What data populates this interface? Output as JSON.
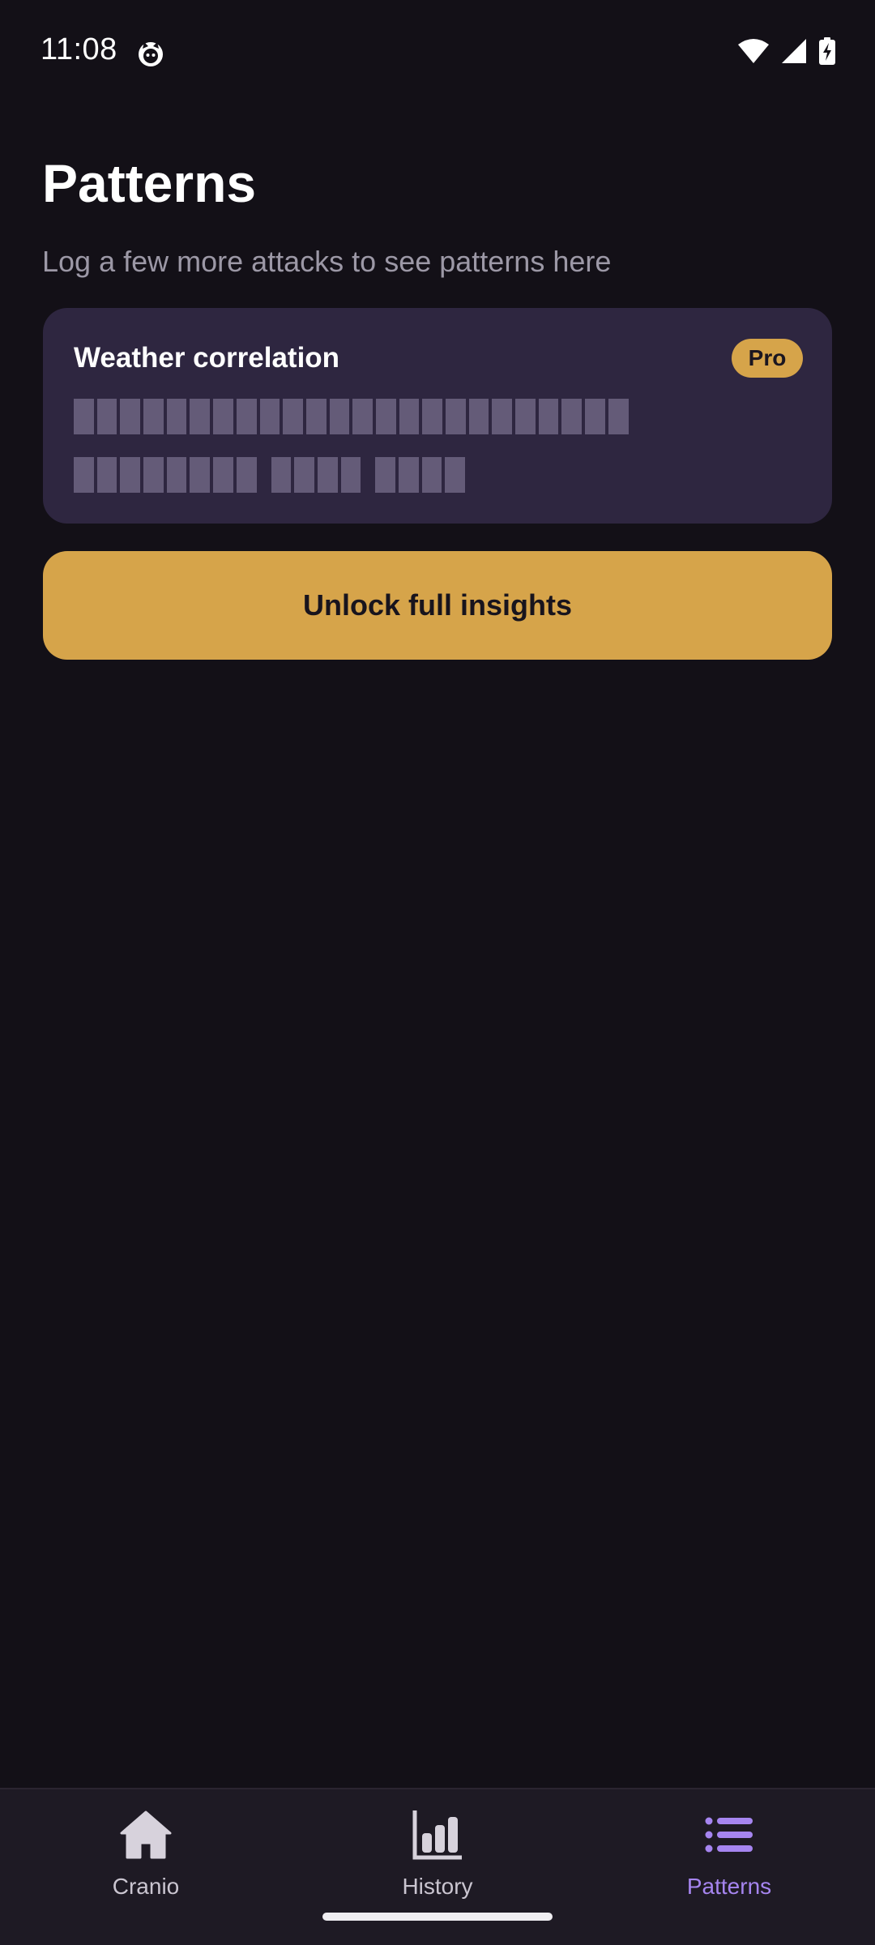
{
  "status_bar": {
    "time": "11:08",
    "app_icon": "cat-face-icon",
    "icons": [
      "wifi-icon",
      "cell-signal-icon",
      "battery-charging-icon"
    ]
  },
  "page": {
    "title": "Patterns",
    "subtitle": "Log a few more attacks to see patterns here"
  },
  "insight_card": {
    "title": "Weather correlation",
    "badge": "Pro"
  },
  "cta": {
    "label": "Unlock full insights"
  },
  "bottom_nav": {
    "items": [
      {
        "label": "Cranio",
        "icon": "home-icon",
        "active": false
      },
      {
        "label": "History",
        "icon": "bar-chart-icon",
        "active": false
      },
      {
        "label": "Patterns",
        "icon": "list-icon",
        "active": true
      }
    ]
  },
  "colors": {
    "background": "#131017",
    "card": "#2e2640",
    "accent_gold": "#d6a44a",
    "active_nav": "#a685f0",
    "placeholder": "#645b78"
  }
}
